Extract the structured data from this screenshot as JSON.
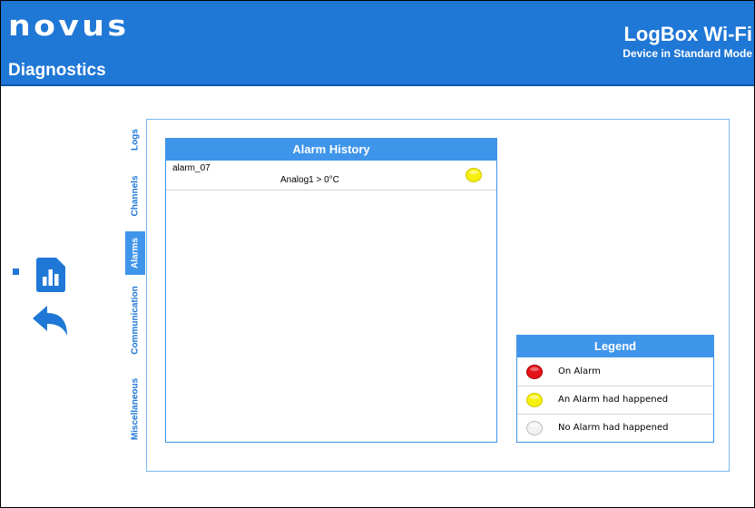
{
  "header": {
    "logo": "novus",
    "page_title": "Diagnostics",
    "product_name": "LogBox Wi-Fi",
    "device_mode": "Device in Standard Mode"
  },
  "colors": {
    "header_bg": "#1f77d6",
    "tab_active": "#3f95ea",
    "led_red": "#e5141a",
    "led_yellow": "#f6f00e",
    "led_gray": "#f2f2f2"
  },
  "sidebar_icons": [
    "diagnostics-chart-icon",
    "back-arrow-icon"
  ],
  "tabs": [
    {
      "label": "Logs",
      "active": false
    },
    {
      "label": "Channels",
      "active": false
    },
    {
      "label": "Alarms",
      "active": true
    },
    {
      "label": "Communication",
      "active": false
    },
    {
      "label": "Miscellaneous",
      "active": false
    }
  ],
  "alarm_history": {
    "title": "Alarm History",
    "rows": [
      {
        "name": "alarm_07",
        "condition": "Analog1 > 0°C",
        "status": "yellow"
      }
    ]
  },
  "legend": {
    "title": "Legend",
    "items": [
      {
        "label": "On Alarm",
        "status": "red"
      },
      {
        "label": "An Alarm had happened",
        "status": "yellow"
      },
      {
        "label": "No Alarm had happened",
        "status": "gray"
      }
    ]
  }
}
